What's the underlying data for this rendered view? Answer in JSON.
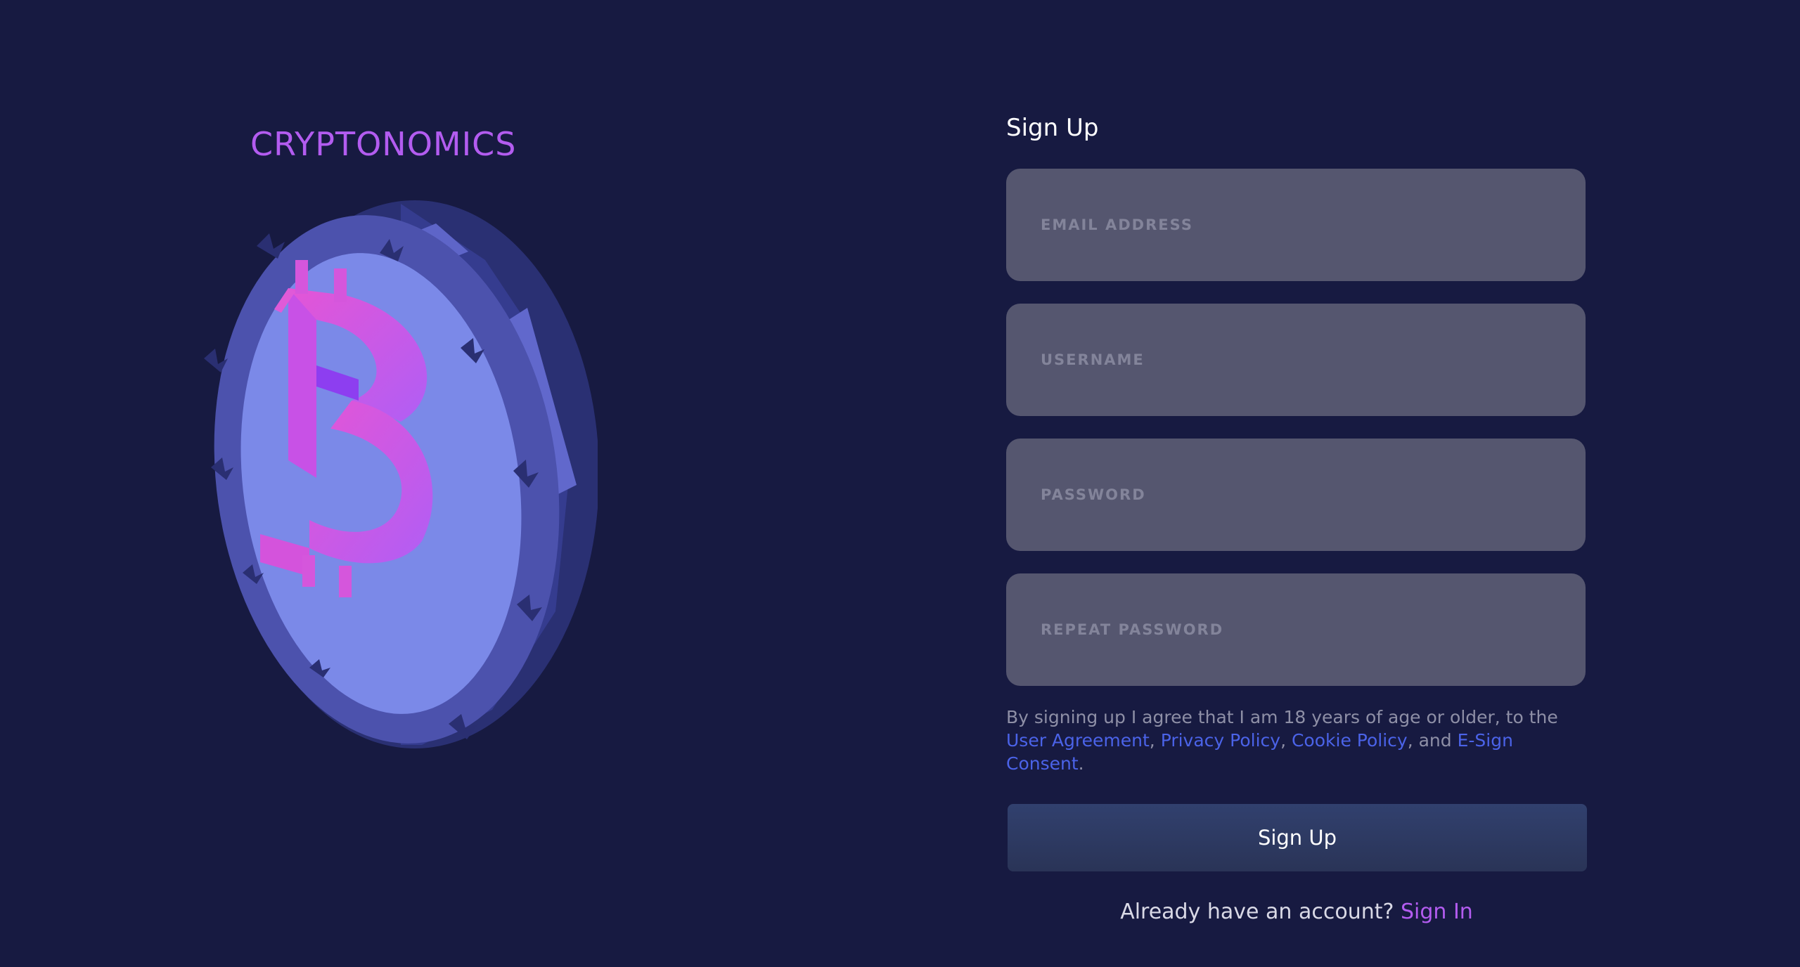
{
  "brand": {
    "name": "CRYPTONOMICS"
  },
  "form": {
    "title": "Sign Up",
    "email_placeholder": "EMAIL ADDRESS",
    "username_placeholder": "USERNAME",
    "password_placeholder": "PASSWORD",
    "repeat_password_placeholder": "REPEAT PASSWORD",
    "terms": {
      "prefix": "By signing up I agree that I am 18 years of age or older, to the ",
      "user_agreement": "User Agreement",
      "sep1": ", ",
      "privacy_policy": "Privacy Policy",
      "sep2": ", ",
      "cookie_policy": "Cookie Policy",
      "sep3": ", and ",
      "esign_consent": "E-Sign Consent",
      "suffix": "."
    },
    "submit_label": "Sign Up",
    "signin_prompt": "Already have an account?",
    "signin_link": "Sign In"
  },
  "colors": {
    "background": "#171a41",
    "brand": "#b35cf0",
    "field": "#55566f",
    "link": "#4b63e8",
    "button": "#2f3c66"
  },
  "icons": {
    "coin": "bitcoin-coin-illustration"
  }
}
